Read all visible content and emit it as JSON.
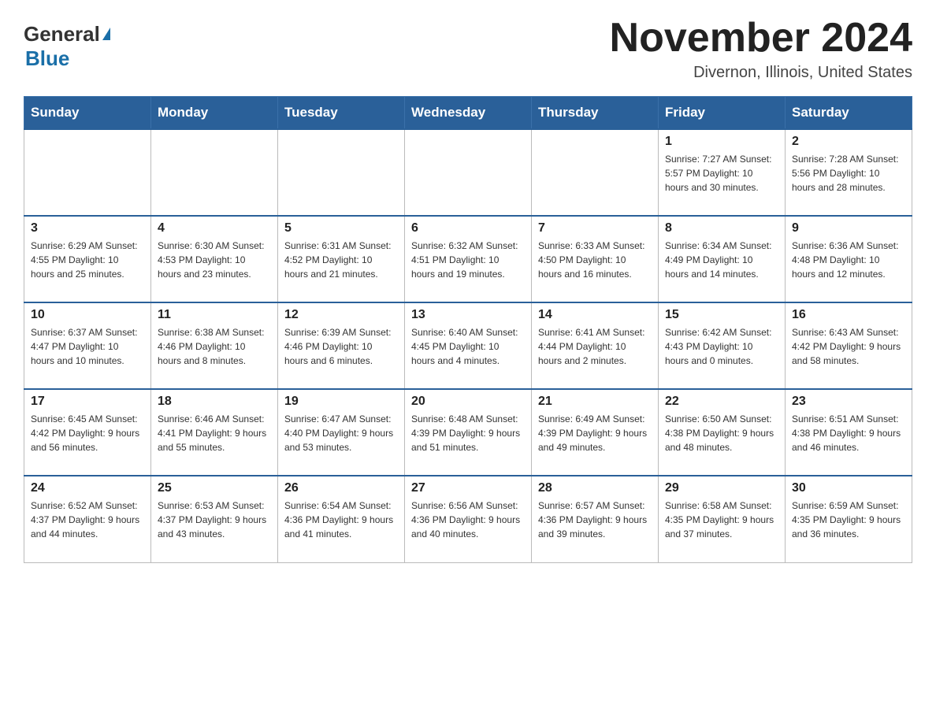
{
  "logo": {
    "general": "General",
    "blue": "Blue",
    "underline": "Blue"
  },
  "header": {
    "title": "November 2024",
    "subtitle": "Divernon, Illinois, United States"
  },
  "days_of_week": [
    "Sunday",
    "Monday",
    "Tuesday",
    "Wednesday",
    "Thursday",
    "Friday",
    "Saturday"
  ],
  "weeks": [
    {
      "cells": [
        {
          "day": "",
          "info": ""
        },
        {
          "day": "",
          "info": ""
        },
        {
          "day": "",
          "info": ""
        },
        {
          "day": "",
          "info": ""
        },
        {
          "day": "",
          "info": ""
        },
        {
          "day": "1",
          "info": "Sunrise: 7:27 AM\nSunset: 5:57 PM\nDaylight: 10 hours\nand 30 minutes."
        },
        {
          "day": "2",
          "info": "Sunrise: 7:28 AM\nSunset: 5:56 PM\nDaylight: 10 hours\nand 28 minutes."
        }
      ]
    },
    {
      "cells": [
        {
          "day": "3",
          "info": "Sunrise: 6:29 AM\nSunset: 4:55 PM\nDaylight: 10 hours\nand 25 minutes."
        },
        {
          "day": "4",
          "info": "Sunrise: 6:30 AM\nSunset: 4:53 PM\nDaylight: 10 hours\nand 23 minutes."
        },
        {
          "day": "5",
          "info": "Sunrise: 6:31 AM\nSunset: 4:52 PM\nDaylight: 10 hours\nand 21 minutes."
        },
        {
          "day": "6",
          "info": "Sunrise: 6:32 AM\nSunset: 4:51 PM\nDaylight: 10 hours\nand 19 minutes."
        },
        {
          "day": "7",
          "info": "Sunrise: 6:33 AM\nSunset: 4:50 PM\nDaylight: 10 hours\nand 16 minutes."
        },
        {
          "day": "8",
          "info": "Sunrise: 6:34 AM\nSunset: 4:49 PM\nDaylight: 10 hours\nand 14 minutes."
        },
        {
          "day": "9",
          "info": "Sunrise: 6:36 AM\nSunset: 4:48 PM\nDaylight: 10 hours\nand 12 minutes."
        }
      ]
    },
    {
      "cells": [
        {
          "day": "10",
          "info": "Sunrise: 6:37 AM\nSunset: 4:47 PM\nDaylight: 10 hours\nand 10 minutes."
        },
        {
          "day": "11",
          "info": "Sunrise: 6:38 AM\nSunset: 4:46 PM\nDaylight: 10 hours\nand 8 minutes."
        },
        {
          "day": "12",
          "info": "Sunrise: 6:39 AM\nSunset: 4:46 PM\nDaylight: 10 hours\nand 6 minutes."
        },
        {
          "day": "13",
          "info": "Sunrise: 6:40 AM\nSunset: 4:45 PM\nDaylight: 10 hours\nand 4 minutes."
        },
        {
          "day": "14",
          "info": "Sunrise: 6:41 AM\nSunset: 4:44 PM\nDaylight: 10 hours\nand 2 minutes."
        },
        {
          "day": "15",
          "info": "Sunrise: 6:42 AM\nSunset: 4:43 PM\nDaylight: 10 hours\nand 0 minutes."
        },
        {
          "day": "16",
          "info": "Sunrise: 6:43 AM\nSunset: 4:42 PM\nDaylight: 9 hours\nand 58 minutes."
        }
      ]
    },
    {
      "cells": [
        {
          "day": "17",
          "info": "Sunrise: 6:45 AM\nSunset: 4:42 PM\nDaylight: 9 hours\nand 56 minutes."
        },
        {
          "day": "18",
          "info": "Sunrise: 6:46 AM\nSunset: 4:41 PM\nDaylight: 9 hours\nand 55 minutes."
        },
        {
          "day": "19",
          "info": "Sunrise: 6:47 AM\nSunset: 4:40 PM\nDaylight: 9 hours\nand 53 minutes."
        },
        {
          "day": "20",
          "info": "Sunrise: 6:48 AM\nSunset: 4:39 PM\nDaylight: 9 hours\nand 51 minutes."
        },
        {
          "day": "21",
          "info": "Sunrise: 6:49 AM\nSunset: 4:39 PM\nDaylight: 9 hours\nand 49 minutes."
        },
        {
          "day": "22",
          "info": "Sunrise: 6:50 AM\nSunset: 4:38 PM\nDaylight: 9 hours\nand 48 minutes."
        },
        {
          "day": "23",
          "info": "Sunrise: 6:51 AM\nSunset: 4:38 PM\nDaylight: 9 hours\nand 46 minutes."
        }
      ]
    },
    {
      "cells": [
        {
          "day": "24",
          "info": "Sunrise: 6:52 AM\nSunset: 4:37 PM\nDaylight: 9 hours\nand 44 minutes."
        },
        {
          "day": "25",
          "info": "Sunrise: 6:53 AM\nSunset: 4:37 PM\nDaylight: 9 hours\nand 43 minutes."
        },
        {
          "day": "26",
          "info": "Sunrise: 6:54 AM\nSunset: 4:36 PM\nDaylight: 9 hours\nand 41 minutes."
        },
        {
          "day": "27",
          "info": "Sunrise: 6:56 AM\nSunset: 4:36 PM\nDaylight: 9 hours\nand 40 minutes."
        },
        {
          "day": "28",
          "info": "Sunrise: 6:57 AM\nSunset: 4:36 PM\nDaylight: 9 hours\nand 39 minutes."
        },
        {
          "day": "29",
          "info": "Sunrise: 6:58 AM\nSunset: 4:35 PM\nDaylight: 9 hours\nand 37 minutes."
        },
        {
          "day": "30",
          "info": "Sunrise: 6:59 AM\nSunset: 4:35 PM\nDaylight: 9 hours\nand 36 minutes."
        }
      ]
    }
  ]
}
